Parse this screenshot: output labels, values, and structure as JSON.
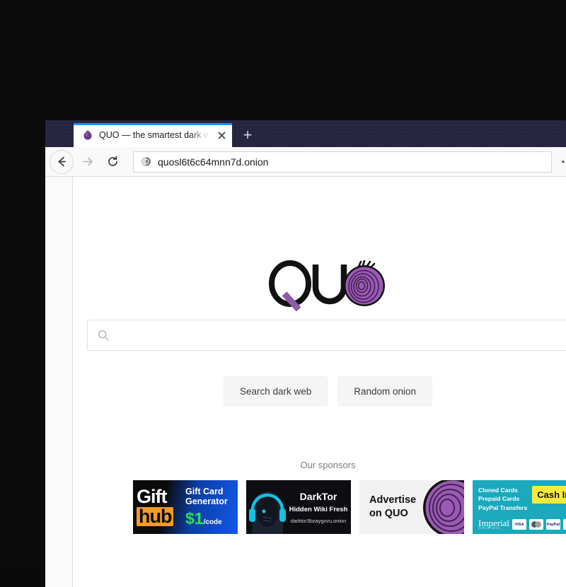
{
  "browser": {
    "tab": {
      "title": "QUO — the smartest dark web s",
      "favicon_icon": "onion-icon",
      "close_icon": "close-icon"
    },
    "new_tab_label": "+",
    "nav": {
      "back_icon": "arrow-left-icon",
      "forward_icon": "arrow-right-icon",
      "reload_icon": "reload-icon"
    },
    "url_bar": {
      "site_icon": "onion-identity-icon",
      "url": "quosl6t6c64mnn7d.onion"
    },
    "page_menu_label": "•••"
  },
  "page": {
    "logo": {
      "text": "QUO",
      "onion_color": "#9b59b6",
      "accent_color": "#8e5aa8"
    },
    "search": {
      "value": "",
      "placeholder": "",
      "icon": "search-icon"
    },
    "buttons": [
      {
        "label": "Search dark web",
        "name": "search-dark-web-button"
      },
      {
        "label": "Random onion",
        "name": "random-onion-button"
      }
    ],
    "sponsors": {
      "heading": "Our sponsors",
      "banners": [
        {
          "name": "sponsor-gifthub",
          "brand_top": "Gift",
          "brand_bottom": "hub",
          "line1": "Gift Card",
          "line2": "Generator",
          "price": "$1",
          "price_suffix": "/code"
        },
        {
          "name": "sponsor-darktor",
          "title": "DarkTor",
          "subtitle": "Hidden Wiki Fresh",
          "url": "darktor3bzaygvvu.onion"
        },
        {
          "name": "sponsor-advertise",
          "line1": "Advertise",
          "line2": "on QUO"
        },
        {
          "name": "sponsor-imperial",
          "line1": "Cloned Cards",
          "line2": "Prepaid Cards",
          "line3": "PayPal Transfers",
          "cta": "Cash In",
          "brand": "Imperial",
          "brand_sub": "SINCE 2014",
          "cards": [
            "VISA",
            "",
            "PayPal",
            "MC"
          ]
        }
      ]
    }
  }
}
